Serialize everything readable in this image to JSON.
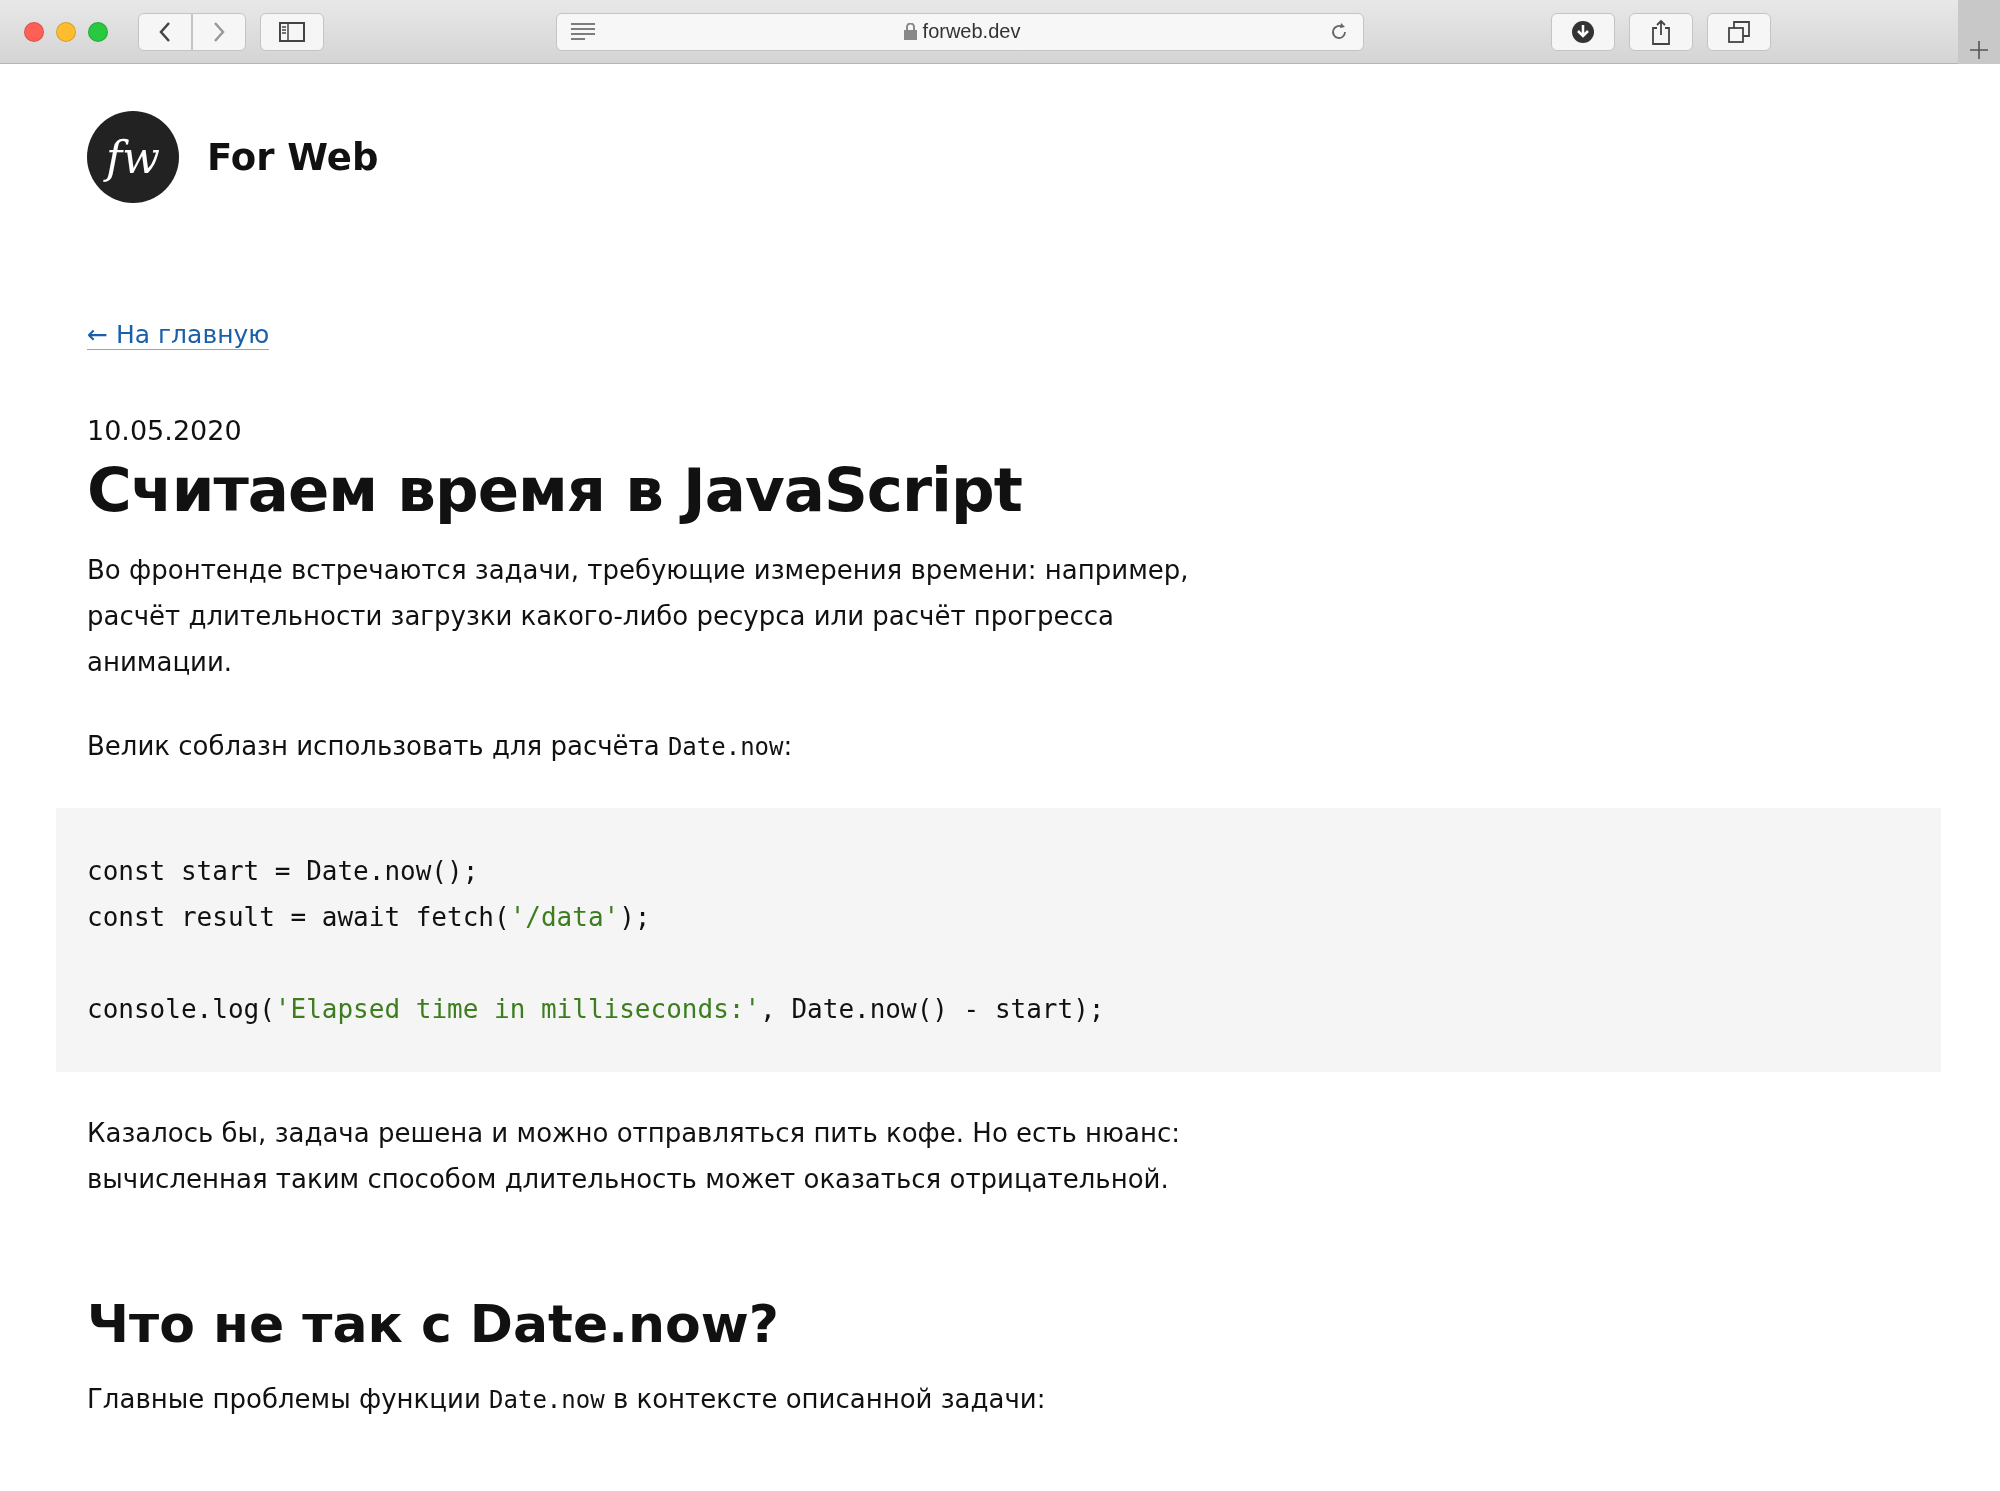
{
  "browser": {
    "url": "forweb.dev"
  },
  "site": {
    "logo": "fw",
    "name": "For Web"
  },
  "back_link": "← На главную",
  "article": {
    "date": "10.05.2020",
    "title": "Считаем время в JavaScript",
    "blocks": [
      {
        "kind": "paragraph",
        "segments": [
          {
            "kind": "text",
            "text": "Во фронтенде встречаются задачи, требующие измерения времени: например, расчёт длительности загрузки какого-либо ресурса или расчёт прогресса анимации."
          }
        ]
      },
      {
        "kind": "paragraph",
        "segments": [
          {
            "kind": "text",
            "text": "Велик соблазн использовать для расчёта "
          },
          {
            "kind": "code",
            "text": "Date.now"
          },
          {
            "kind": "text",
            "text": ":"
          }
        ]
      },
      {
        "kind": "code",
        "lines": [
          {
            "kind": "code",
            "tokens": [
              {
                "kind": "plain",
                "text": "const start = Date.now();"
              }
            ]
          },
          {
            "kind": "code",
            "tokens": [
              {
                "kind": "plain",
                "text": "const result = await fetch("
              },
              {
                "kind": "string",
                "text": "'/data'"
              },
              {
                "kind": "plain",
                "text": ");"
              }
            ]
          },
          {
            "kind": "blank"
          },
          {
            "kind": "code",
            "tokens": [
              {
                "kind": "plain",
                "text": "console.log("
              },
              {
                "kind": "string",
                "text": "'Elapsed time in milliseconds:'"
              },
              {
                "kind": "plain",
                "text": ", Date.now() - start);"
              }
            ]
          }
        ]
      },
      {
        "kind": "paragraph",
        "segments": [
          {
            "kind": "text",
            "text": "Казалось бы, задача решена и можно отправляться пить кофе. Но есть нюанс: вычисленная таким способом длительность может оказаться отрицательной."
          }
        ]
      },
      {
        "kind": "heading",
        "text": "Что не так с Date.now?"
      },
      {
        "kind": "paragraph",
        "segments": [
          {
            "kind": "text",
            "text": "Главные проблемы функции "
          },
          {
            "kind": "code",
            "text": "Date.now"
          },
          {
            "kind": "text",
            "text": " в контексте описанной задачи:"
          }
        ]
      }
    ]
  }
}
